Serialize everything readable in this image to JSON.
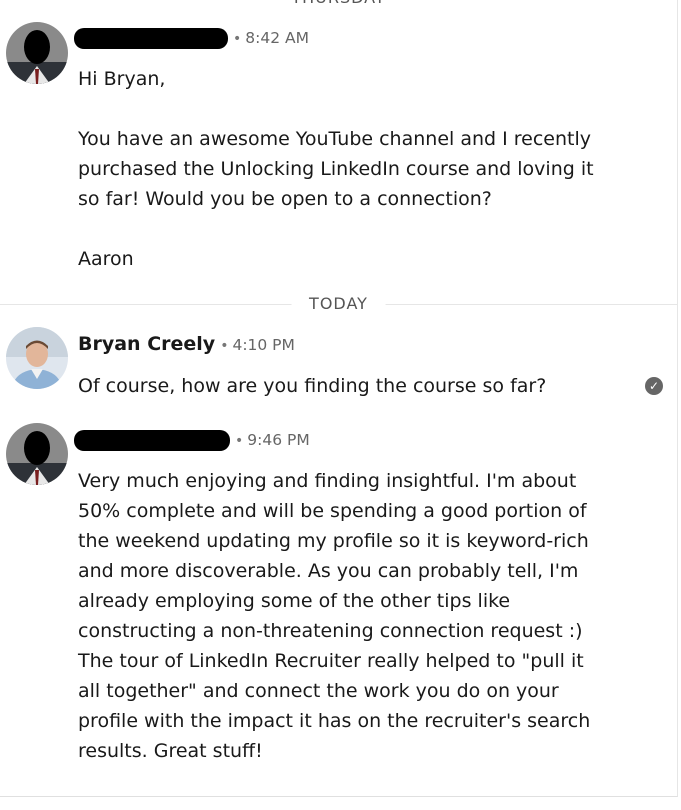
{
  "dividers": {
    "top": "THURSDAY",
    "today": "TODAY"
  },
  "messages": [
    {
      "sender_visible": "",
      "time": "8:42 AM",
      "paragraphs": [
        "Hi Bryan,",
        "You have an awesome YouTube channel and I recently purchased the Unlocking LinkedIn course and loving it so far! Would you be open to a connection?",
        "Aaron"
      ]
    },
    {
      "sender": "Bryan Creely",
      "time": "4:10 PM",
      "text": "Of course, how are you finding the course so far?"
    },
    {
      "sender_visible": "",
      "time": "9:46 PM",
      "text": "Very much enjoying and finding insightful.  I'm about 50% complete and will  be spending a good portion of the weekend updating my profile so it is keyword-rich and more discoverable.  As you can probably tell, I'm already employing some of the other tips like constructing a non-threatening connection request :) The tour of LinkedIn Recruiter really helped to \"pull it all together\" and connect the work you do on your profile with the impact it has on the recruiter's search results.  Great stuff!"
    }
  ],
  "icons": {
    "read_receipt": "check-circle-icon"
  }
}
